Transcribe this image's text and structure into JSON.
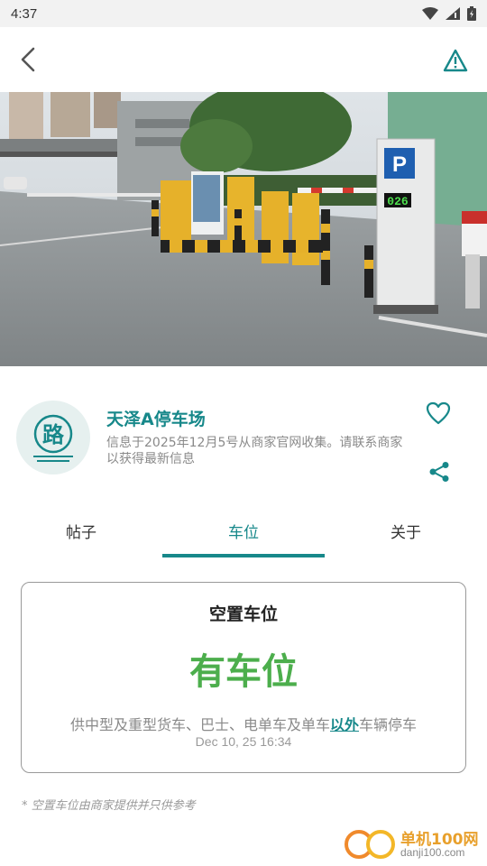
{
  "status_bar": {
    "time": "4:37",
    "icons": [
      "wifi-icon",
      "signal-icon",
      "battery-icon"
    ]
  },
  "app_bar": {
    "back_icon": "chevron-left-icon",
    "report_icon": "warning-icon"
  },
  "hero": {
    "parking_sign_letter": "P",
    "available_display": "026"
  },
  "carpark": {
    "logo_char": "路",
    "name": "天泽A停车场",
    "info": "信息于2025年12月5号从商家官网收集。请联系商家以获得最新信息"
  },
  "tabs": [
    {
      "label": "帖子",
      "active": false
    },
    {
      "label": "车位",
      "active": true
    },
    {
      "label": "关于",
      "active": false
    }
  ],
  "vacancy_card": {
    "title": "空置车位",
    "status": "有车位",
    "note_before": "供中型及重型货车、巴士、电单车及单车",
    "note_highlight": "以外",
    "note_after": "车辆停车",
    "timestamp": "Dec 10, 25 16:34"
  },
  "disclaimer": "* 空置车位由商家提供并只供参考",
  "watermark": {
    "title": "单机100网",
    "url": "danji100.com"
  },
  "colors": {
    "accent": "#17888a",
    "available": "#4cae4c",
    "muted": "#8a8a8a"
  }
}
